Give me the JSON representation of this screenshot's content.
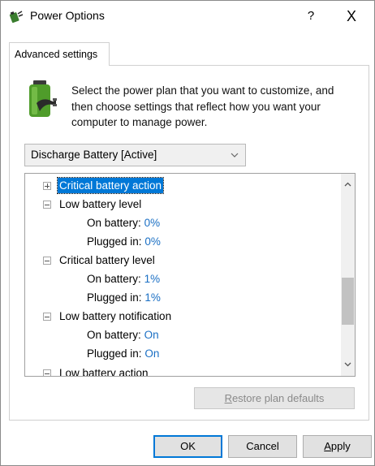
{
  "window": {
    "title": "Power Options",
    "help_label": "?",
    "close_label": "X"
  },
  "tab": {
    "label": "Advanced settings"
  },
  "description": "Select the power plan that you want to customize, and then choose settings that reflect how you want your computer to manage power.",
  "plan_select": {
    "value": "Discharge Battery [Active]"
  },
  "tree": {
    "items": [
      {
        "label": "Critical battery action",
        "expander": "plus",
        "selected": true
      },
      {
        "label": "Low battery level",
        "expander": "minus"
      },
      {
        "label": "On battery:",
        "value": "0%"
      },
      {
        "label": "Plugged in:",
        "value": "0%"
      },
      {
        "label": "Critical battery level",
        "expander": "minus"
      },
      {
        "label": "On battery:",
        "value": "1%"
      },
      {
        "label": "Plugged in:",
        "value": "1%"
      },
      {
        "label": "Low battery notification",
        "expander": "minus"
      },
      {
        "label": "On battery:",
        "value": "On"
      },
      {
        "label": "Plugged in:",
        "value": "On"
      },
      {
        "label": "Low battery action",
        "expander": "minus"
      }
    ]
  },
  "buttons": {
    "restore": {
      "label_underlined": "R",
      "label_rest": "estore plan defaults"
    },
    "ok": "OK",
    "cancel": "Cancel",
    "apply": {
      "label_underlined": "A",
      "label_rest": "pply"
    }
  },
  "icons": {
    "app": "power-options-icon",
    "battery": "battery-plug-icon",
    "dropdown": "chevron-down-icon",
    "scroll_up": "chevron-up-icon",
    "scroll_down": "chevron-down-icon"
  }
}
